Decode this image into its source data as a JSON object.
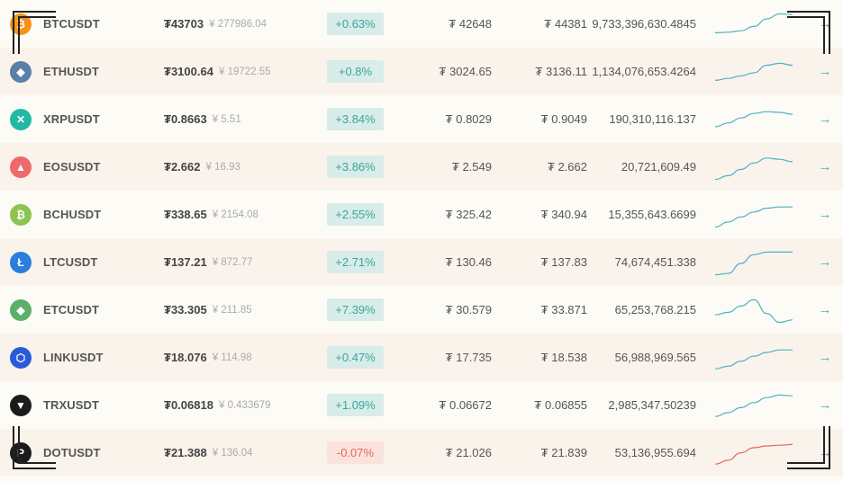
{
  "currency_symbol": "₮",
  "cny_symbol": "¥",
  "colors": {
    "up_bg": "#d8ece9",
    "up_text": "#3aa79b",
    "down_bg": "#fbe3dd",
    "down_text": "#e5655a",
    "spark_up": "#4fb1c7",
    "spark_down": "#e5655a"
  },
  "rows": [
    {
      "pair": "BTCUSDT",
      "icon": "bitcoin-icon",
      "icon_color": "#f7931a",
      "icon_glyph": "₿",
      "price": "43703",
      "cny": "277986.04",
      "change": "+0.63%",
      "direction": "up",
      "low": "42648",
      "high": "44381",
      "volume": "9,733,396,630.4845",
      "spark": [
        0.2,
        0.22,
        0.28,
        0.45,
        0.75,
        0.95,
        0.92
      ]
    },
    {
      "pair": "ETHUSDT",
      "icon": "ethereum-icon",
      "icon_color": "#5a7fa8",
      "icon_glyph": "◆",
      "price": "3100.64",
      "cny": "19722.55",
      "change": "+0.8%",
      "direction": "up",
      "low": "3024.65",
      "high": "3136.11",
      "volume": "1,134,076,653.4264",
      "spark": [
        0.2,
        0.28,
        0.38,
        0.5,
        0.8,
        0.88,
        0.8
      ]
    },
    {
      "pair": "XRPUSDT",
      "icon": "ripple-icon",
      "icon_color": "#22b8a6",
      "icon_glyph": "✕",
      "price": "0.8663",
      "cny": "5.51",
      "change": "+3.84%",
      "direction": "up",
      "low": "0.8029",
      "high": "0.9049",
      "volume": "190,310,116.137",
      "spark": [
        0.25,
        0.4,
        0.6,
        0.78,
        0.85,
        0.82,
        0.75
      ]
    },
    {
      "pair": "EOSUSDT",
      "icon": "eos-icon",
      "icon_color": "#ee6a6a",
      "icon_glyph": "▲",
      "price": "2.662",
      "cny": "16.93",
      "change": "+3.86%",
      "direction": "up",
      "low": "2.549",
      "high": "2.662",
      "volume": "20,721,609.49",
      "spark": [
        0.05,
        0.2,
        0.45,
        0.7,
        0.9,
        0.85,
        0.75
      ]
    },
    {
      "pair": "BCHUSDT",
      "icon": "bitcoin-cash-icon",
      "icon_color": "#8dc351",
      "icon_glyph": "₿",
      "price": "338.65",
      "cny": "2154.08",
      "change": "+2.55%",
      "direction": "up",
      "low": "325.42",
      "high": "340.94",
      "volume": "15,355,643.6699",
      "spark": [
        0.05,
        0.25,
        0.45,
        0.65,
        0.8,
        0.85,
        0.85
      ]
    },
    {
      "pair": "LTCUSDT",
      "icon": "litecoin-icon",
      "icon_color": "#2b7de0",
      "icon_glyph": "Ł",
      "price": "137.21",
      "cny": "872.77",
      "change": "+2.71%",
      "direction": "up",
      "low": "130.46",
      "high": "137.83",
      "volume": "74,674,451.338",
      "spark": [
        0.05,
        0.1,
        0.5,
        0.85,
        0.95,
        0.95,
        0.95
      ]
    },
    {
      "pair": "ETCUSDT",
      "icon": "ethereum-classic-icon",
      "icon_color": "#5ab066",
      "icon_glyph": "◆",
      "price": "33.305",
      "cny": "211.85",
      "change": "+7.39%",
      "direction": "up",
      "low": "30.579",
      "high": "33.871",
      "volume": "65,253,768.215",
      "spark": [
        0.35,
        0.45,
        0.7,
        0.95,
        0.4,
        0.05,
        0.15
      ]
    },
    {
      "pair": "LINKUSDT",
      "icon": "chainlink-icon",
      "icon_color": "#2a5ada",
      "icon_glyph": "⬡",
      "price": "18.076",
      "cny": "114.98",
      "change": "+0.47%",
      "direction": "up",
      "low": "17.735",
      "high": "18.538",
      "volume": "56,988,969.565",
      "spark": [
        0.1,
        0.2,
        0.4,
        0.6,
        0.75,
        0.85,
        0.85
      ]
    },
    {
      "pair": "TRXUSDT",
      "icon": "tron-icon",
      "icon_color": "#1b1b1b",
      "icon_glyph": "▼",
      "price": "0.06818",
      "cny": "0.433679",
      "change": "+1.09%",
      "direction": "up",
      "low": "0.06672",
      "high": "0.06855",
      "volume": "2,985,347.50239",
      "spark": [
        0.1,
        0.25,
        0.45,
        0.65,
        0.85,
        0.95,
        0.92
      ]
    },
    {
      "pair": "DOTUSDT",
      "icon": "polkadot-icon",
      "icon_color": "#1b1b1b",
      "icon_glyph": "P",
      "price": "21.388",
      "cny": "136.04",
      "change": "-0.07%",
      "direction": "down",
      "low": "21.026",
      "high": "21.839",
      "volume": "53,136,955.694",
      "spark": [
        0.1,
        0.25,
        0.55,
        0.75,
        0.82,
        0.85,
        0.88
      ]
    }
  ]
}
